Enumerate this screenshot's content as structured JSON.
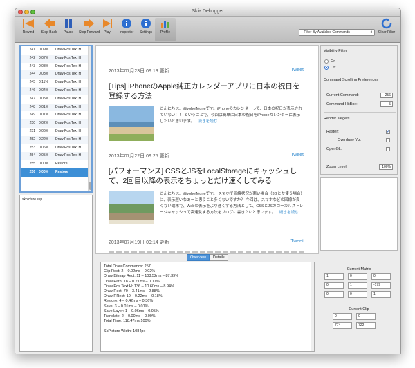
{
  "window": {
    "title": "Skia Debugger"
  },
  "toolbar": {
    "buttons": [
      {
        "label": "Rewind"
      },
      {
        "label": "Step Back"
      },
      {
        "label": "Pause"
      },
      {
        "label": "Step Forward"
      },
      {
        "label": "Play"
      },
      {
        "label": "Inspector"
      },
      {
        "label": "Settings"
      },
      {
        "label": "Profile"
      }
    ],
    "filter": "--Filter By Available Commands--",
    "clear_filter": "Clear Filter"
  },
  "commands": [
    {
      "num": "241",
      "pct": "0.09%",
      "name": "Draw Pos Text H"
    },
    {
      "num": "242",
      "pct": "0.07%",
      "name": "Draw Pos Text H"
    },
    {
      "num": "243",
      "pct": "0.08%",
      "name": "Draw Pos Text H"
    },
    {
      "num": "244",
      "pct": "0.03%",
      "name": "Draw Pos Text H"
    },
    {
      "num": "245",
      "pct": "0.11%",
      "name": "Draw Pos Text H"
    },
    {
      "num": "246",
      "pct": "0.04%",
      "name": "Draw Pos Text H"
    },
    {
      "num": "247",
      "pct": "0.05%",
      "name": "Draw Pos Text H"
    },
    {
      "num": "248",
      "pct": "0.01%",
      "name": "Draw Pos Text H"
    },
    {
      "num": "249",
      "pct": "0.01%",
      "name": "Draw Pos Text H"
    },
    {
      "num": "250",
      "pct": "0.02%",
      "name": "Draw Pos Text H"
    },
    {
      "num": "251",
      "pct": "0.06%",
      "name": "Draw Pos Text H"
    },
    {
      "num": "252",
      "pct": "0.22%",
      "name": "Draw Pos Text H"
    },
    {
      "num": "253",
      "pct": "0.06%",
      "name": "Draw Pos Text H"
    },
    {
      "num": "254",
      "pct": "0.05%",
      "name": "Draw Pos Text H"
    },
    {
      "num": "255",
      "pct": "0.00%",
      "name": "Restore"
    },
    {
      "num": "256",
      "pct": "0.00%",
      "name": "Restore"
    }
  ],
  "files": [
    "skpicture.skp"
  ],
  "articles": [
    {
      "date": "2013年07月23日 09:13 更新",
      "tweet": "Tweet",
      "title": "[Tips] iPhoneのApple純正カレンダーアプリに日本の祝日を登録する方法",
      "body": "こんにちは、@yoheiMuneです。iPhoneのカレンダーって、日本の祝日が表示されていない！！ ということで、今回は簡単に日本の祝日をiPhoneカレンダーに表示したいと思います。",
      "more": "…続きを読む"
    },
    {
      "date": "2013年07月22日 09:25 更新",
      "tweet": "Tweet",
      "title": "[パフォーマンス] CSSとJSをLocalStorageにキャッシュして、2回目以降の表示をちょっとだけ速くしてみる",
      "body": "こんにちは、@yoheiMuneです。 スマホで回線状況が悪い場合（3Gとか使う場合）に、表示遅いなぁーと思うこと多くないですか？ 今回は、スマホなどの回線が良くない端末で、Webの表示をより速くする方法として、CSSとJSのローカルストレージキャッシュで高速化する方法をブログに書きたいと思います。",
      "more": "…続きを読む"
    },
    {
      "date": "2013年07月19日 09:14 更新",
      "tweet": "Tweet"
    }
  ],
  "visibility": {
    "title": "Visibility Filter",
    "on": "On",
    "off": "Off",
    "selected": "Off"
  },
  "scrolling": {
    "title": "Command Scrolling Preferences",
    "current_label": "Current Command:",
    "current_value": "256",
    "hitbox_label": "Command HitBox:",
    "hitbox_value": "5"
  },
  "render": {
    "title": "Render Targets",
    "raster": "Raster:",
    "raster_checked": true,
    "overdraw": "Overdraw Viz:",
    "opengl": "OpenGL:"
  },
  "zoom": {
    "label": "Zoom Level:",
    "value": "100%"
  },
  "overview": {
    "tabs": [
      "Overview",
      "Details"
    ],
    "lines": "Total Draw Commands: 257\nClip Rect: 2 – 0.02ms – 0.02%\nDraw Bitmap Rect: 11 – 103.52ms – 87.39%\nDraw Path: 18 – 0.21ms – 0.17%\nDraw Pos Text H: 136 – 10.60ms – 8.94%\nDraw Rect: 70 – 3.41ms – 2.88%\nDraw RRect: 10 – 0.22ms – 0.18%\nRestore: 4 – 0.42ms – 0.36%\nSave: 3 – 0.01ms – 0.01%\nSave Layer: 1 – 0.06ms – 0.05%\nTranslate: 2 – 0.00ms – 0.00%\nTotal Time: 118.47ms 100%\n\nSkPicture Width: 1084px"
  },
  "matrix": {
    "title": "Current Matrix",
    "cells": [
      "1",
      "0",
      "0",
      "0",
      "1",
      "-179",
      "0",
      "0",
      "1"
    ]
  },
  "clip": {
    "title": "Current Clip",
    "cells": [
      "0",
      "0",
      "774",
      "722"
    ]
  },
  "colors": {
    "accent": "#3d8fd6",
    "link": "#3a8fd0",
    "toolbar_icon": "#e8882a"
  }
}
